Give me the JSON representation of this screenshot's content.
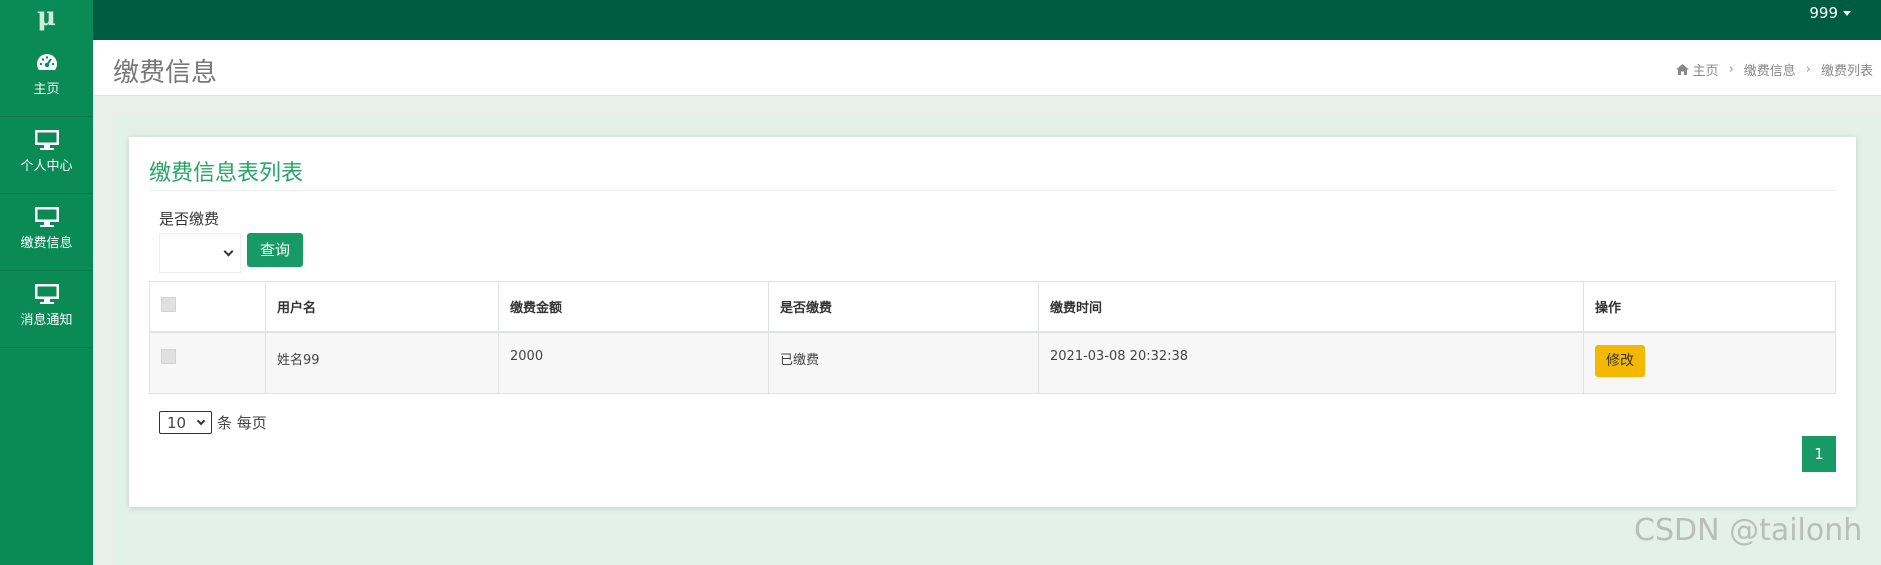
{
  "app": {
    "logo": "μ"
  },
  "topbar": {
    "user": "999"
  },
  "sidebar": {
    "items": [
      {
        "label": "主页",
        "icon": "dashboard-icon"
      },
      {
        "label": "个人中心",
        "icon": "monitor-icon"
      },
      {
        "label": "缴费信息",
        "icon": "monitor-icon"
      },
      {
        "label": "消息通知",
        "icon": "monitor-icon"
      }
    ]
  },
  "header": {
    "title": "缴费信息",
    "breadcrumb": [
      "主页",
      "缴费信息",
      "缴费列表"
    ]
  },
  "card": {
    "title": "缴费信息表列表",
    "filter_label": "是否缴费",
    "filter_value": "",
    "query_label": "查询"
  },
  "table": {
    "headers": [
      "",
      "用户名",
      "缴费金额",
      "是否缴费",
      "缴费时间",
      "操作"
    ],
    "rows": [
      {
        "username": "姓名99",
        "amount": "2000",
        "paid": "已缴费",
        "time": "2021-03-08 20:32:38",
        "action": "修改"
      }
    ]
  },
  "pagination": {
    "page_size": "10",
    "page_size_suffix": "条 每页",
    "current_page": "1"
  },
  "watermark": "CSDN @tailonh",
  "colors": {
    "topbar": "#005c40",
    "sidebar": "#0a8a55",
    "accent": "#179a66",
    "edit": "#f5b800",
    "title": "#27a567"
  }
}
